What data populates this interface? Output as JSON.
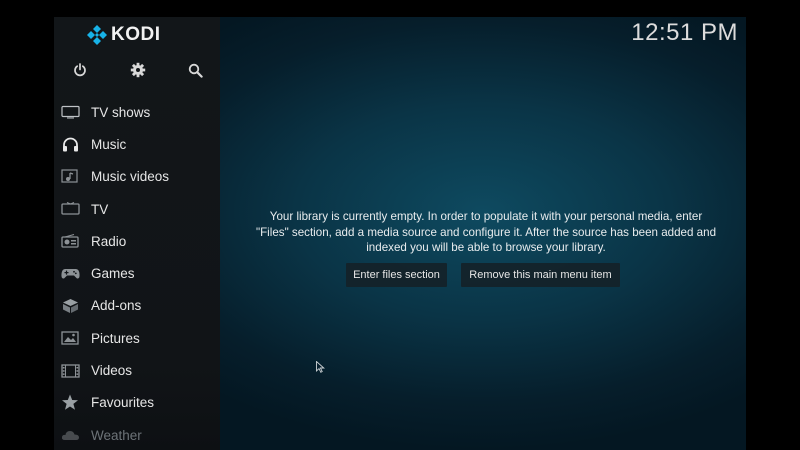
{
  "app": {
    "logo_text": "KODI",
    "clock": "12:51 PM"
  },
  "top_icons": [
    {
      "icon": "power-icon"
    },
    {
      "icon": "gear-icon"
    },
    {
      "icon": "search-icon"
    }
  ],
  "menu": {
    "items": [
      {
        "label": "TV shows",
        "icon": "tv-shows-icon"
      },
      {
        "label": "Music",
        "icon": "headphones-icon"
      },
      {
        "label": "Music videos",
        "icon": "music-videos-icon"
      },
      {
        "label": "TV",
        "icon": "tv-icon"
      },
      {
        "label": "Radio",
        "icon": "radio-icon"
      },
      {
        "label": "Games",
        "icon": "gamepad-icon"
      },
      {
        "label": "Add-ons",
        "icon": "addons-box-icon"
      },
      {
        "label": "Pictures",
        "icon": "pictures-icon"
      },
      {
        "label": "Videos",
        "icon": "videos-icon"
      },
      {
        "label": "Favourites",
        "icon": "star-icon"
      },
      {
        "label": "Weather",
        "icon": "weather-icon"
      }
    ]
  },
  "main": {
    "message_line1": "Your library is currently empty. In order to populate it with your personal media, enter",
    "message_line2": "\"Files\" section, add a media source and configure it. After the source has been added and",
    "message_line3": "indexed you will be able to browse your library.",
    "enter_files_label": "Enter files section",
    "remove_item_label": "Remove this main menu item"
  },
  "colors": {
    "background": "#0a3446",
    "sidebar": "#121619",
    "text": "#e6e6e6",
    "logo_blue": "#17b2e7"
  }
}
